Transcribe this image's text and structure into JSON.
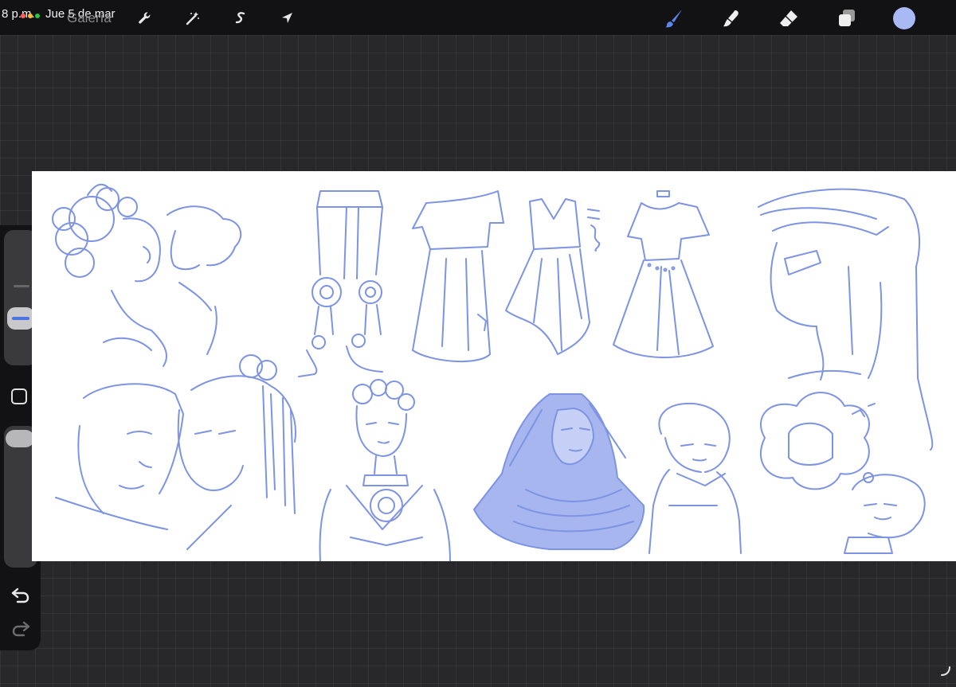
{
  "status_bar": {
    "time": "8 p.m.",
    "date": "Jue 5 de mar"
  },
  "toolbar": {
    "gallery_label": "Galería",
    "left_tools": [
      "wrench-icon",
      "magic-wand-icon",
      "selection-icon",
      "transform-arrow-icon"
    ],
    "right_tools": [
      "brush-icon",
      "smudge-icon",
      "eraser-icon",
      "layers-icon"
    ],
    "active_tool": "brush-icon",
    "current_color": "#a9b9f4"
  },
  "sidebar": {
    "controls": [
      "brush-size-slider",
      "modify-button",
      "opacity-slider",
      "undo-icon",
      "redo-icon"
    ]
  },
  "canvas": {
    "background": "#ffffff",
    "ink_color": "#7d93e4",
    "sketches": [
      "couple-kissing-curly-hair",
      "armored-legs-sandals",
      "draped-dress-1",
      "draped-dress-2",
      "gown-with-belt",
      "spartan-helmet-profile",
      "two-faces-cheek-to-cheek",
      "curly-hair-figure-with-jewelry",
      "veiled-woman-filled",
      "short-hair-hooded-figure",
      "thought-bubble-chibi"
    ]
  }
}
